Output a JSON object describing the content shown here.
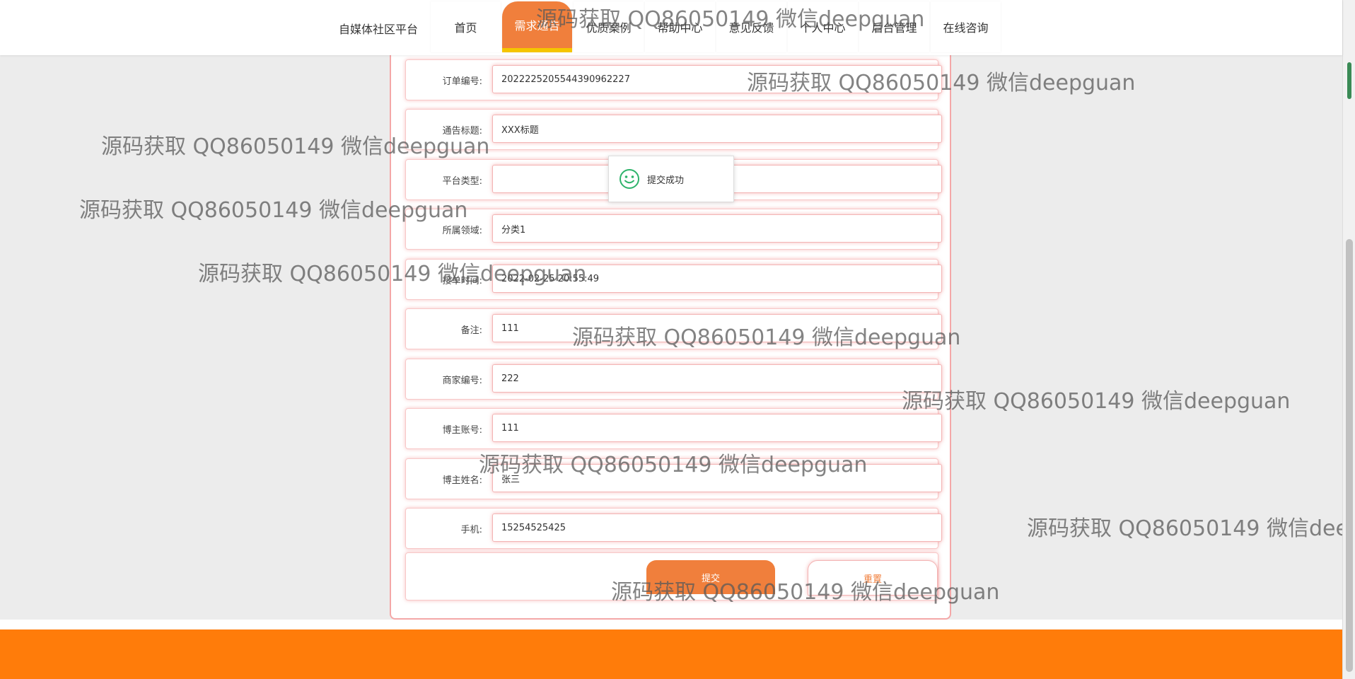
{
  "header": {
    "site_title": "自媒体社区平台",
    "nav": [
      {
        "label": "首页",
        "active": false
      },
      {
        "label": "需求通告",
        "active": true
      },
      {
        "label": "优质案例",
        "active": false
      },
      {
        "label": "帮助中心",
        "active": false
      },
      {
        "label": "意见反馈",
        "active": false
      },
      {
        "label": "个人中心",
        "active": false
      },
      {
        "label": "后台管理",
        "active": false
      },
      {
        "label": "在线咨询",
        "active": false
      }
    ]
  },
  "form": {
    "fields": [
      {
        "label": "订单编号:",
        "value": "2022225205544390962227"
      },
      {
        "label": "通告标题:",
        "value": "XXX标题"
      },
      {
        "label": "平台类型:",
        "value": ""
      },
      {
        "label": "所属领域:",
        "value": "分类1"
      },
      {
        "label": "接单时间:",
        "value": "2022-02-25 20:55:49"
      },
      {
        "label": "备注:",
        "value": "111"
      },
      {
        "label": "商家编号:",
        "value": "222"
      },
      {
        "label": "博主账号:",
        "value": "111"
      },
      {
        "label": "博主姓名:",
        "value": "张三"
      },
      {
        "label": "手机:",
        "value": "15254525425"
      }
    ],
    "submit_label": "提交",
    "reset_label": "重置"
  },
  "toast": {
    "message": "提交成功",
    "icon": "smiley-icon"
  },
  "watermark_text": "源码获取 QQ86050149 微信deepguan",
  "colors": {
    "accent": "#f07f3c",
    "active_underline": "#f5c500",
    "footer": "#ff7c0a",
    "field_glow": "#f3b4b4"
  }
}
